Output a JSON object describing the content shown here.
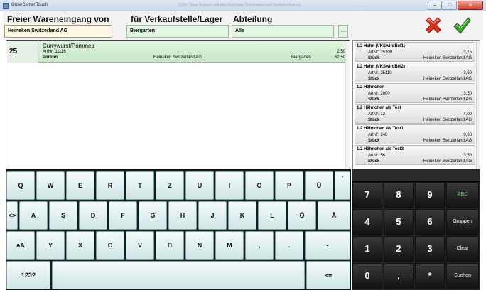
{
  "window": {
    "title": "OrderCenter Touch",
    "hint": "OCMH Neue Scanner und eine Buchungs-Terminations und Gerätebedienung"
  },
  "header": {
    "label_from": "Freier Wareneingang von",
    "label_to": "für Verkaufstelle/Lager",
    "label_dept": "Abteilung",
    "supplier": "Heineken Switzerland AG",
    "location": "Biergarten",
    "department": "Alle",
    "more_button": "...",
    "cancel_icon": "cancel-x-icon",
    "confirm_icon": "confirm-check-icon"
  },
  "order": {
    "qty": "25",
    "name": "Currywurst/Pommes",
    "artnr": "ArtNr: 11116",
    "unit": "Portion",
    "supplier": "Heineken Switzerland AG",
    "location": "Biergarten",
    "unit_price": "2,50",
    "total": "62,50"
  },
  "articles": [
    {
      "name": "1/2 Hahn (VKSwirdBel1)",
      "artnr": "ArtNr: 25109",
      "price": "3,75",
      "unit": "Stück",
      "supplier": "Heineken Switzerland AG"
    },
    {
      "name": "1/2 Hahn (VKSwirdBel2)",
      "artnr": "ArtNr: 25110",
      "price": "3,60",
      "unit": "Stück",
      "supplier": "Heineken Switzerland AG"
    },
    {
      "name": "1/2 Hähnchen",
      "artnr": "ArtNr: 2000",
      "price": "3,50",
      "unit": "Stück",
      "supplier": "Heineken Switzerland AG"
    },
    {
      "name": "1/2 Hähnchen als Test",
      "artnr": "ArtNr: 12",
      "price": "4,00",
      "unit": "Stück",
      "supplier": "Heineken Switzerland AG"
    },
    {
      "name": "1/2 Hähnchen als Test1",
      "artnr": "ArtNr: 248",
      "price": "3,60",
      "unit": "Stück",
      "supplier": "Heineken Switzerland AG"
    },
    {
      "name": "1/2 Hähnchen als Test3",
      "artnr": "ArtNr: 56",
      "price": "3,50",
      "unit": "Stück",
      "supplier": "Heineken Switzerland AG"
    }
  ],
  "keyboard": {
    "row1": [
      "Q",
      "W",
      "E",
      "R",
      "T",
      "Z",
      "U",
      "I",
      "O",
      "P",
      "Ü",
      "´"
    ],
    "row2": [
      "<>",
      "A",
      "S",
      "D",
      "F",
      "G",
      "H",
      "J",
      "K",
      "L",
      "Ö",
      "Ä"
    ],
    "row3": [
      "aA",
      "Y",
      "X",
      "C",
      "V",
      "B",
      "N",
      "M",
      ",",
      ".",
      "-"
    ],
    "mode_key": "123?",
    "backspace": "<="
  },
  "numpad": {
    "row1": [
      "7",
      "8",
      "9"
    ],
    "row2": [
      "4",
      "5",
      "6"
    ],
    "row3": [
      "1",
      "2",
      "3"
    ],
    "row4": [
      "0",
      ",",
      "*"
    ],
    "func": [
      "ABC",
      "Gruppen",
      "Clear",
      "Suchen"
    ]
  },
  "colors": {
    "field_green": "#e3f5e3",
    "field_active": "#fdf7e3",
    "cancel_red": "#e0301e",
    "confirm_green": "#3aa32a",
    "abc_green": "#7ed37e"
  }
}
